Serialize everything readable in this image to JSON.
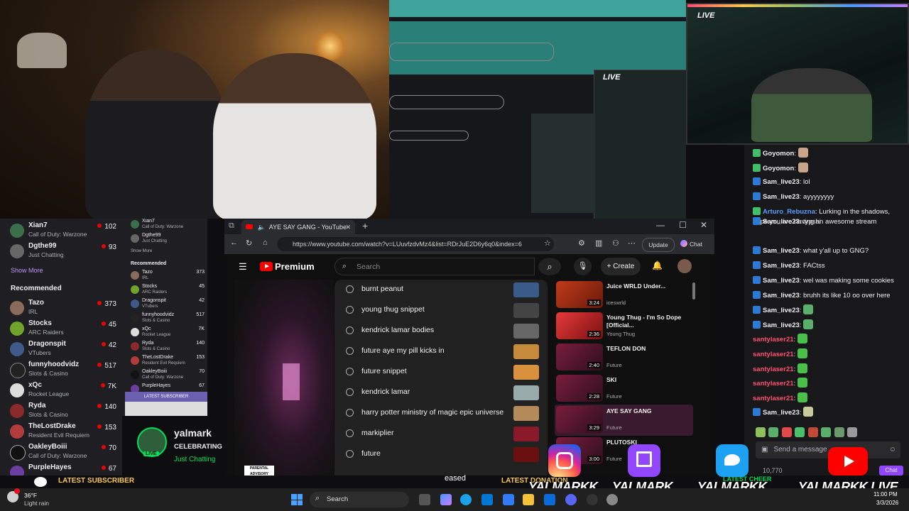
{
  "browser": {
    "tab_title": "AYE SAY GANG - YouTube",
    "url": "https://www.youtube.com/watch?v=LUuvfzdvMz4&list=RDrJuE2D6y6q0&index=6",
    "update_label": "Update",
    "chat_label": "Chat"
  },
  "youtube": {
    "logo": "Premium",
    "search_placeholder": "Search",
    "create_label": "Create",
    "suggestions": [
      "burnt peanut",
      "young thug snippet",
      "kendrick lamar bodies",
      "future aye my pill kicks in",
      "future snippet",
      "kendrick lamar",
      "harry potter ministry of magic epic universe",
      "markiplier",
      "future"
    ],
    "playlist": [
      {
        "title": "Juice WRLD Under...",
        "artist": "iceswrld",
        "duration": "3:24"
      },
      {
        "title": "Young Thug - I'm So Dope [Official...",
        "artist": "Young Thug",
        "duration": "2:36"
      },
      {
        "title": "TEFLON DON",
        "artist": "Future",
        "duration": "2:40"
      },
      {
        "title": "SKI",
        "artist": "Future",
        "duration": "2:28"
      },
      {
        "title": "AYE SAY GANG",
        "artist": "Future",
        "duration": "3:29"
      },
      {
        "title": "PLUTOSKI",
        "artist": "Future",
        "duration": "3:00"
      }
    ],
    "parental": "PARENTAL ADVISORY"
  },
  "sidebar": {
    "top_items": [
      {
        "name": "Xian7",
        "game": "Call of Duty: Warzone",
        "viewers": "102"
      },
      {
        "name": "Dgthe99",
        "game": "Just Chatting",
        "viewers": "93"
      }
    ],
    "show_more": "Show More",
    "recommended_label": "Recommended",
    "recommended": [
      {
        "name": "Tazo",
        "game": "IRL",
        "viewers": "373"
      },
      {
        "name": "Stocks",
        "game": "ARC Raiders",
        "viewers": "45"
      },
      {
        "name": "Dragonspit",
        "game": "VTubers",
        "viewers": "42"
      },
      {
        "name": "funnyhoodvidz",
        "game": "Slots & Casino",
        "viewers": "517"
      },
      {
        "name": "xQc",
        "game": "Rocket League",
        "viewers": "7K"
      },
      {
        "name": "Ryda",
        "game": "Slots & Casino",
        "viewers": "140"
      },
      {
        "name": "TheLostDrake",
        "game": "Resident Evil Requiem",
        "viewers": "153"
      },
      {
        "name": "OakleyBoiii",
        "game": "Call of Duty: Warzone",
        "viewers": "70"
      },
      {
        "name": "PurpleHayes",
        "game": "",
        "viewers": "67"
      }
    ]
  },
  "sidebar_small": {
    "items": [
      {
        "name": "Xian7",
        "game": "Call of Duty: Warzone",
        "viewers": ""
      },
      {
        "name": "Dgthe99",
        "game": "Just Chatting",
        "viewers": ""
      }
    ],
    "show_more": "Show More",
    "recommended_label": "Recommended",
    "recommended": [
      {
        "name": "Tazo",
        "game": "IRL",
        "viewers": "373"
      },
      {
        "name": "Stocks",
        "game": "ARC Raiders",
        "viewers": "45"
      },
      {
        "name": "Dragonspit",
        "game": "VTubers",
        "viewers": "42"
      },
      {
        "name": "funnyhoodvidz",
        "game": "Slots & Casino",
        "viewers": "517"
      },
      {
        "name": "xQc",
        "game": "Rocket League",
        "viewers": "7K"
      },
      {
        "name": "Ryda",
        "game": "Slots & Casino",
        "viewers": "140"
      },
      {
        "name": "TheLostDrake",
        "game": "Resident Evil Requiem",
        "viewers": "153"
      },
      {
        "name": "OakleyBoiii",
        "game": "Call of Duty: Warzone",
        "viewers": "70"
      },
      {
        "name": "PurpleHayes",
        "game": "",
        "viewers": "67"
      }
    ],
    "latest_subscriber": "LATEST SUBSCRIBER"
  },
  "stream_card": {
    "name": "yalmark",
    "status": "CELEBRATING S",
    "category": "Just Chatting",
    "live": "LIVE"
  },
  "chat": {
    "messages": [
      {
        "user": "Goyomon",
        "text": "",
        "color": "#efeff1"
      },
      {
        "user": "Goyomon",
        "text": "",
        "color": "#efeff1"
      },
      {
        "user": "Sam_live23",
        "text": "lol",
        "color": "#efeff1"
      },
      {
        "user": "Sam_live23",
        "text": "ayyyyyyyy",
        "color": "#efeff1"
      },
      {
        "user": "Arturo_Rebuzna",
        "text": "Lurking in the shadows, hope you are having an awesome stream",
        "color": "#5c9cff"
      },
      {
        "user": "Sam_live23",
        "text": "typshi",
        "color": "#efeff1"
      },
      {
        "user": "Sam_live23",
        "text": "what y'all up to GNG?",
        "color": "#efeff1"
      },
      {
        "user": "Sam_live23",
        "text": "FACtss",
        "color": "#efeff1"
      },
      {
        "user": "Sam_live23",
        "text": "wel was making some cookies",
        "color": "#efeff1"
      },
      {
        "user": "Sam_live23",
        "text": "bruhh its like 10 oo over here",
        "color": "#efeff1"
      },
      {
        "user": "Sam_live23",
        "text": "",
        "color": "#efeff1"
      },
      {
        "user": "Sam_live23",
        "text": "",
        "color": "#efeff1"
      },
      {
        "user": "santylaser21",
        "text": "",
        "color": "#ff4f6e"
      },
      {
        "user": "santylaser21",
        "text": "",
        "color": "#ff4f6e"
      },
      {
        "user": "santylaser21",
        "text": "",
        "color": "#ff4f6e"
      },
      {
        "user": "santylaser21",
        "text": "",
        "color": "#ff4f6e"
      },
      {
        "user": "santylaser21",
        "text": "",
        "color": "#ff4f6e"
      },
      {
        "user": "Sam_live23",
        "text": "",
        "color": "#efeff1"
      }
    ],
    "input_placeholder": "Send a message",
    "chat_button": "Chat",
    "points": "10,770"
  },
  "overlay": {
    "live_label": "LIVE",
    "latest_subscriber": "LATEST SUBSCRIBER",
    "latest_donation": "LATEST DONATION",
    "latest_cheer": "LATEST CHEER",
    "released": "eased",
    "socials": [
      "YALMARKK",
      "YALMARK",
      "YALMARKK",
      "YALMARKK LIVE"
    ]
  },
  "taskbar": {
    "weather_temp": "36°F",
    "weather_desc": "Light rain",
    "search_label": "Search",
    "time": "11:00 PM",
    "date": "3/3/2026"
  },
  "colors": {
    "twitch_purple": "#9146ff",
    "youtube_red": "#ff0000",
    "live_green": "#00e05a"
  }
}
